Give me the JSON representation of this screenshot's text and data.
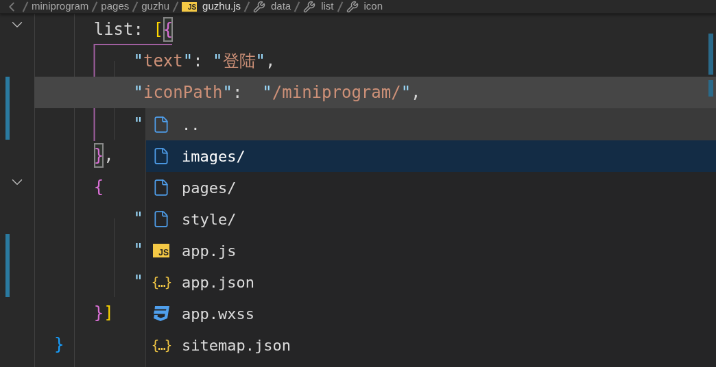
{
  "breadcrumb": [
    {
      "text": "miniprogram",
      "kind": "folder"
    },
    {
      "text": "pages",
      "kind": "folder"
    },
    {
      "text": "guzhu",
      "kind": "folder"
    },
    {
      "text": "guzhu.js",
      "kind": "js",
      "icon_text": "JS"
    },
    {
      "text": "data",
      "kind": "symbol"
    },
    {
      "text": "list",
      "kind": "symbol"
    },
    {
      "text": "icon",
      "kind": "symbol"
    }
  ],
  "code_lines": [
    {
      "fold": true,
      "modified": false,
      "current": false,
      "tokens": [
        {
          "text": "      list: ",
          "kind": "plain"
        },
        {
          "text": "[",
          "kind": "bracket-yellow"
        },
        {
          "text": "{",
          "kind": "bracket-match"
        }
      ]
    },
    {
      "fold": false,
      "modified": false,
      "current": false,
      "tokens": [
        {
          "text": "          \"",
          "kind": "quote"
        },
        {
          "text": "text",
          "kind": "key"
        },
        {
          "text": "\"",
          "kind": "quote"
        },
        {
          "text": ": ",
          "kind": "plain"
        },
        {
          "text": "\"",
          "kind": "quote"
        },
        {
          "text": "登陆",
          "kind": "string"
        },
        {
          "text": "\"",
          "kind": "quote"
        },
        {
          "text": ",",
          "kind": "plain"
        }
      ]
    },
    {
      "fold": false,
      "modified": true,
      "current": true,
      "tokens": [
        {
          "text": "          \"",
          "kind": "quote"
        },
        {
          "text": "iconPath",
          "kind": "key"
        },
        {
          "text": "\"",
          "kind": "quote"
        },
        {
          "text": ":  ",
          "kind": "plain"
        },
        {
          "text": "\"",
          "kind": "quote"
        },
        {
          "text": "/miniprogram/",
          "kind": "string"
        },
        {
          "text": "\"",
          "kind": "quote"
        },
        {
          "text": ",",
          "kind": "plain"
        }
      ]
    },
    {
      "fold": false,
      "modified": true,
      "current": false,
      "tokens": [
        {
          "text": "          \"",
          "kind": "quote"
        }
      ]
    },
    {
      "fold": false,
      "modified": false,
      "current": false,
      "tokens": [
        {
          "text": "      }",
          "kind": "bracket-match"
        },
        {
          "text": ",",
          "kind": "plain"
        }
      ]
    },
    {
      "fold": true,
      "modified": false,
      "current": false,
      "tokens": [
        {
          "text": "      {",
          "kind": "bracket-purple"
        }
      ]
    },
    {
      "fold": false,
      "modified": false,
      "current": false,
      "tokens": [
        {
          "text": "          \"",
          "kind": "quote"
        }
      ]
    },
    {
      "fold": false,
      "modified": true,
      "current": false,
      "tokens": [
        {
          "text": "          \"",
          "kind": "quote"
        }
      ]
    },
    {
      "fold": false,
      "modified": true,
      "current": false,
      "tokens": [
        {
          "text": "          \"",
          "kind": "quote"
        }
      ]
    },
    {
      "fold": false,
      "modified": false,
      "current": false,
      "tokens": [
        {
          "text": "      }",
          "kind": "bracket-purple"
        },
        {
          "text": "]",
          "kind": "bracket-yellow"
        }
      ]
    },
    {
      "fold": false,
      "modified": false,
      "current": false,
      "tokens": [
        {
          "text": "  }",
          "kind": "bracket-blue"
        }
      ]
    }
  ],
  "suggestions": [
    {
      "label": "..",
      "kind": "file",
      "selected": false
    },
    {
      "label": "images/",
      "kind": "file",
      "selected": true
    },
    {
      "label": "pages/",
      "kind": "file",
      "selected": false
    },
    {
      "label": "style/",
      "kind": "file",
      "selected": false
    },
    {
      "label": "app.js",
      "kind": "js",
      "icon_text": "JS",
      "selected": false
    },
    {
      "label": "app.json",
      "kind": "json",
      "icon_text": "{…}",
      "selected": false
    },
    {
      "label": "app.wxss",
      "kind": "css",
      "selected": false
    },
    {
      "label": "sitemap.json",
      "kind": "json",
      "icon_text": "{…}",
      "selected": false
    }
  ]
}
